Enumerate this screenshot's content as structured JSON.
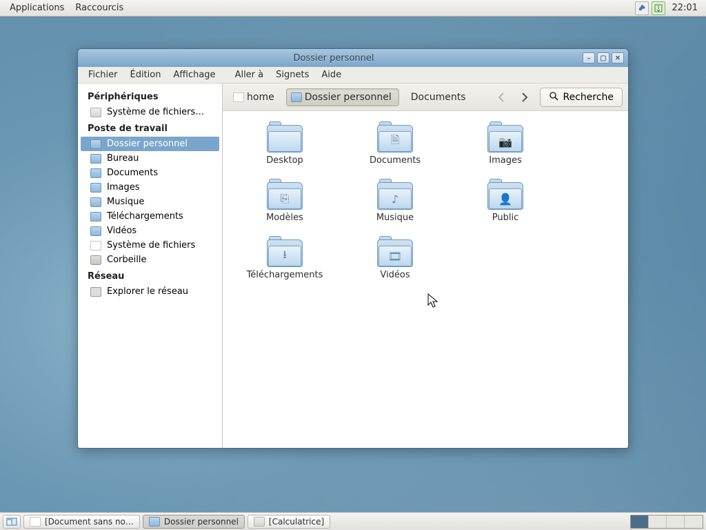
{
  "top_panel": {
    "applications": "Applications",
    "shortcuts": "Raccourcis",
    "clock": "22:01"
  },
  "bottom_panel": {
    "tasks": [
      {
        "label": "[Document sans no…",
        "icon": "doc"
      },
      {
        "label": "Dossier personnel",
        "icon": "folder",
        "active": true
      },
      {
        "label": "[Calculatrice]",
        "icon": "calc"
      }
    ]
  },
  "window": {
    "title": "Dossier personnel",
    "menus": [
      "Fichier",
      "Édition",
      "Affichage",
      "Aller à",
      "Signets",
      "Aide"
    ],
    "path": [
      {
        "label": "home",
        "icon": "doc"
      },
      {
        "label": "Dossier personnel",
        "icon": "home",
        "current": true
      },
      {
        "label": "Documents"
      }
    ],
    "search_label": "Recherche",
    "sidebar": {
      "devices_header": "Périphériques",
      "devices": [
        {
          "label": "Système de fichiers…",
          "icon": "gray"
        }
      ],
      "computer_header": "Poste de travail",
      "computer": [
        {
          "label": "Dossier personnel",
          "icon": "folder",
          "selected": true
        },
        {
          "label": "Bureau",
          "icon": "folder"
        },
        {
          "label": "Documents",
          "icon": "folder"
        },
        {
          "label": "Images",
          "icon": "folder"
        },
        {
          "label": "Musique",
          "icon": "folder"
        },
        {
          "label": "Téléchargements",
          "icon": "folder"
        },
        {
          "label": "Vidéos",
          "icon": "folder"
        },
        {
          "label": "Système de fichiers",
          "icon": "doc"
        },
        {
          "label": "Corbeille",
          "icon": "trash"
        }
      ],
      "network_header": "Réseau",
      "network": [
        {
          "label": "Explorer le réseau",
          "icon": "net"
        }
      ]
    },
    "folders": [
      {
        "label": "Desktop",
        "glyph": ""
      },
      {
        "label": "Documents",
        "glyph": "🗎"
      },
      {
        "label": "Images",
        "glyph": "📷"
      },
      {
        "label": "Modèles",
        "glyph": "⎘"
      },
      {
        "label": "Musique",
        "glyph": "♪"
      },
      {
        "label": "Public",
        "glyph": "👤"
      },
      {
        "label": "Téléchargements",
        "glyph": "⭳"
      },
      {
        "label": "Vidéos",
        "glyph": "🎞"
      }
    ]
  }
}
